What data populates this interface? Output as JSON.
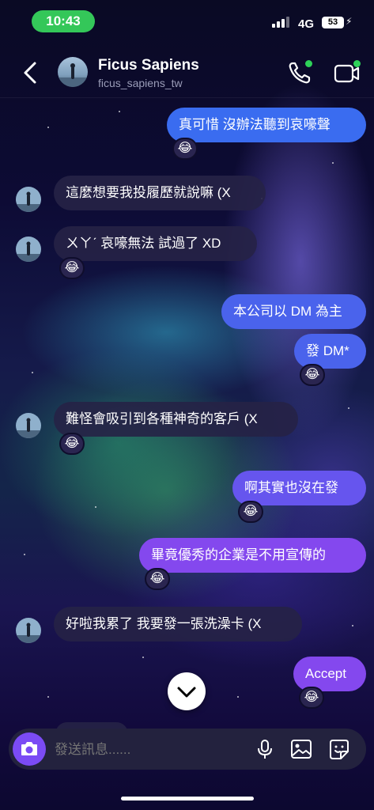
{
  "status_bar": {
    "time": "10:43",
    "network": "4G",
    "battery": "53"
  },
  "header": {
    "name": "Ficus Sapiens",
    "handle": "ficus_sapiens_tw"
  },
  "messages": [
    {
      "direction": "out",
      "text": "真可惜 沒辦法聽到哀嚎聲",
      "reaction": "😂"
    },
    {
      "direction": "in",
      "text": "這麼想要我投履歷就說嘛 (X",
      "reaction": ""
    },
    {
      "direction": "in",
      "text": "ㄨㄚˊ 哀嚎無法 試過了 XD",
      "reaction": "😂"
    },
    {
      "direction": "out",
      "text": "本公司以 DM 為主",
      "reaction": ""
    },
    {
      "direction": "out",
      "text": "發 DM*",
      "reaction": "😂"
    },
    {
      "direction": "in",
      "text": "難怪會吸引到各種神奇的客戶 (X",
      "reaction": "😂"
    },
    {
      "direction": "out",
      "text": "啊其實也沒在發",
      "reaction": "😂"
    },
    {
      "direction": "out",
      "text": "畢竟優秀的企業是不用宣傳的",
      "reaction": "😂"
    },
    {
      "direction": "in",
      "text": "好啦我累了 我要發一張洗澡卡 (X",
      "reaction": ""
    },
    {
      "direction": "out",
      "text": "Accept",
      "reaction": "😂"
    }
  ],
  "composer": {
    "placeholder": "發送訊息......"
  },
  "icons": {
    "back": "chevron-left-icon",
    "call": "phone-icon",
    "video": "video-camera-icon",
    "scroll": "chevron-down-icon",
    "camera": "camera-icon",
    "mic": "microphone-icon",
    "gallery": "image-icon",
    "sticker": "sticker-icon"
  },
  "colors": {
    "status_pill": "#34c759",
    "online": "#2ed158",
    "incoming_bubble": "#262246",
    "outgoing_gradient": [
      "#3a6cf0",
      "#4a63ec",
      "#6655ee",
      "#8448ee"
    ],
    "camera_button": "#7b4bf5"
  }
}
